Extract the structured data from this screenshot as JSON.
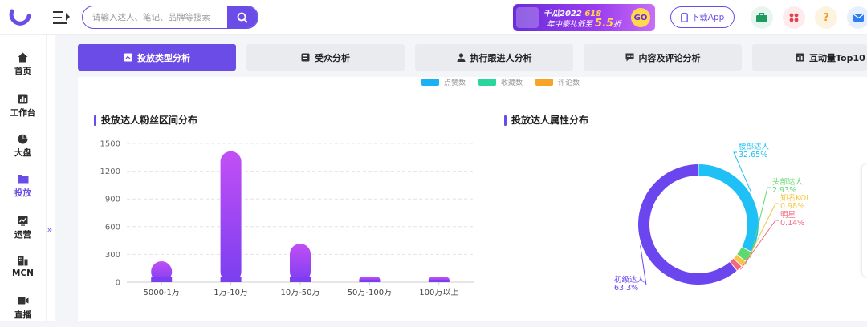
{
  "search": {
    "placeholder": "请输入达人、笔记、品牌等搜索"
  },
  "banner": {
    "line1_prefix": "千瓜2022",
    "line1_accent": "618",
    "line2_prefix": "年中豪礼低至",
    "line2_accent": "5.5",
    "line2_suffix": "折",
    "go_label": "GO"
  },
  "header": {
    "download_label": "下载App",
    "icons": [
      "briefcase-icon",
      "apps-icon",
      "help-icon",
      "mail-icon"
    ]
  },
  "sidebar": {
    "items": [
      {
        "label": "首页",
        "icon": "home-icon"
      },
      {
        "label": "工作台",
        "icon": "workbench-icon"
      },
      {
        "label": "大盘",
        "icon": "pie-icon"
      },
      {
        "label": "投放",
        "icon": "folder-icon",
        "active": true
      },
      {
        "label": "运营",
        "icon": "trend-icon"
      },
      {
        "label": "MCN",
        "icon": "building-icon"
      },
      {
        "label": "直播",
        "icon": "video-icon"
      }
    ],
    "collapse_label": "»"
  },
  "tabs": [
    {
      "label": "投放类型分析",
      "icon": "doc-icon",
      "active": true
    },
    {
      "label": "受众分析",
      "icon": "card-icon"
    },
    {
      "label": "执行跟进人分析",
      "icon": "user-icon"
    },
    {
      "label": "内容及评论分析",
      "icon": "comment-icon"
    },
    {
      "label": "互动量Top10",
      "icon": "bar-icon"
    }
  ],
  "top_legend": [
    {
      "label": "点赞数",
      "color": "#1ab2f5"
    },
    {
      "label": "收藏数",
      "color": "#2bd69a"
    },
    {
      "label": "评论数",
      "color": "#f7a52a"
    }
  ],
  "colors": {
    "accent": "#6b4ce6",
    "bar_top": "#c24ff5",
    "bar_bottom": "#7b3ff0"
  },
  "chart_data": [
    {
      "type": "bar",
      "title": "投放达人粉丝区间分布",
      "categories": [
        "5000-1万",
        "1万-10万",
        "10万-50万",
        "50万-100万",
        "100万以上"
      ],
      "values": [
        225,
        1415,
        415,
        55,
        18
      ],
      "ylim": [
        0,
        1500
      ],
      "yticks": [
        0,
        300,
        600,
        900,
        1200,
        1500
      ],
      "grid": true
    },
    {
      "type": "pie",
      "title": "投放达人属性分布",
      "labels": [
        "腰部达人",
        "头部达人",
        "知名KOL",
        "明星",
        "初级达人"
      ],
      "values": [
        32.65,
        2.93,
        0.98,
        0.14,
        63.3
      ],
      "value_labels": [
        "32.65%",
        "2.93%",
        "0.98%",
        "0.14%",
        "63.3%"
      ],
      "colors": [
        "#1ec0f5",
        "#5fd86f",
        "#f5c748",
        "#f36a7e",
        "#6b46ee"
      ]
    }
  ]
}
